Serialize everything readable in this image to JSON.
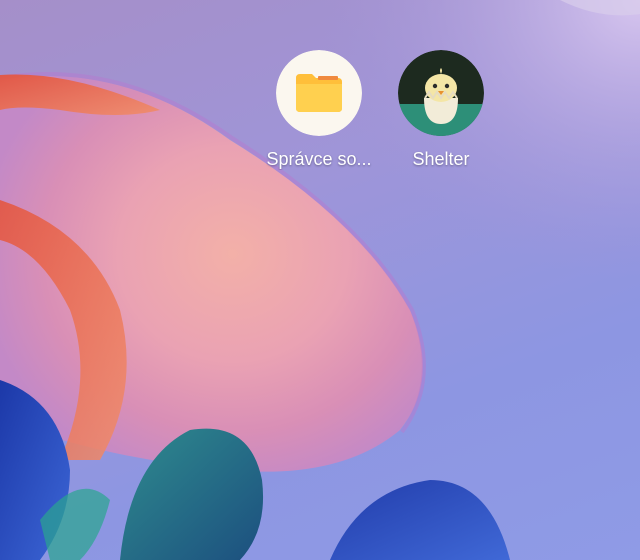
{
  "home_screen": {
    "apps": [
      {
        "label": "Správce so...",
        "icon": "folder-icon",
        "icon_color": "#ffca45",
        "icon_bg": "#fbf7ef"
      },
      {
        "label": "Shelter",
        "icon": "hatching-chick-egg-icon",
        "icon_color": "#2d8f78",
        "icon_bg": "#1d2a1f"
      }
    ]
  },
  "wallpaper": {
    "colors": {
      "sky": "#9f95d8",
      "petal_pink": "#e7a6b8",
      "petal_orange": "#e86f4d",
      "deep_blue": "#2a4fc0",
      "teal": "#2f7f8a"
    }
  }
}
